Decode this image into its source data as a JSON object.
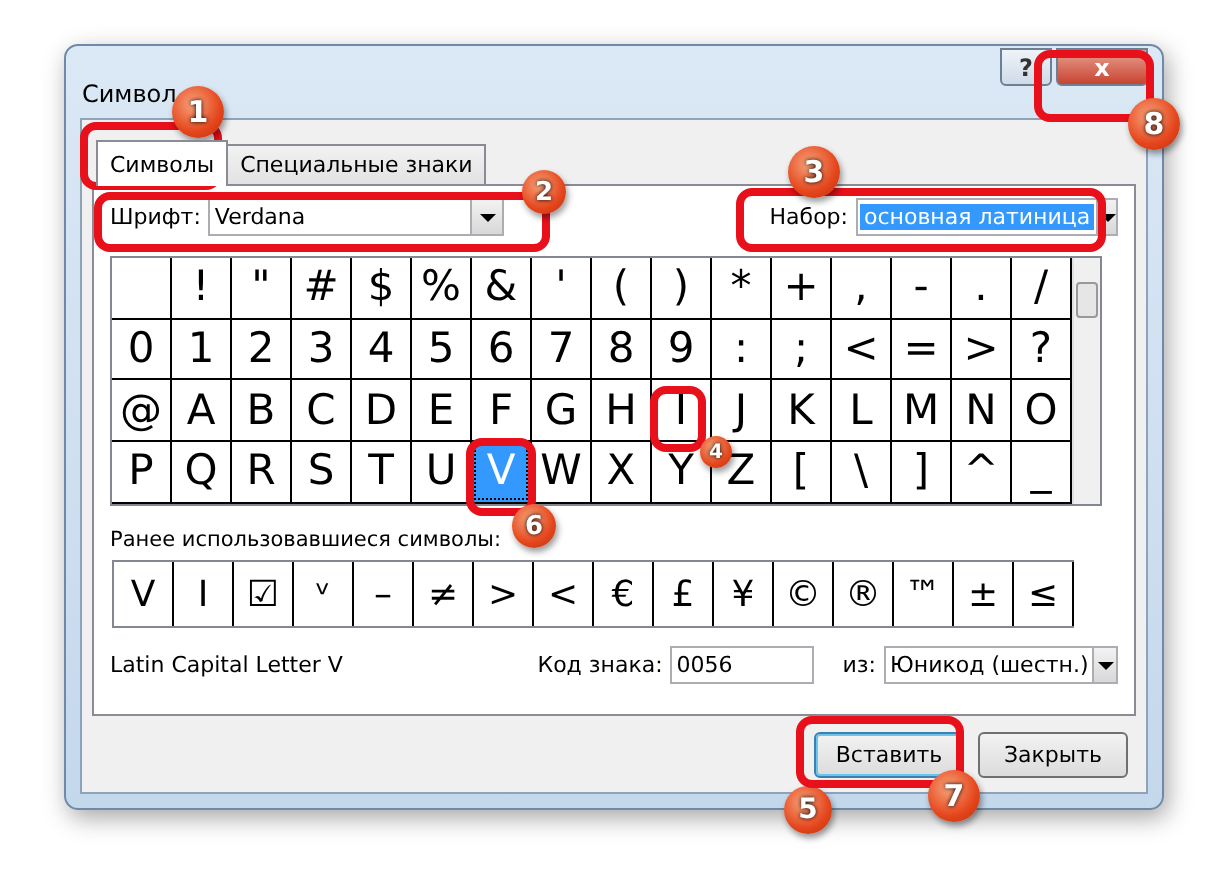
{
  "window": {
    "title": "Символ",
    "help_button": "?",
    "close_button": "x"
  },
  "tabs": [
    {
      "label": "Символы",
      "selected": true
    },
    {
      "label": "Специальные знаки",
      "selected": false
    }
  ],
  "font": {
    "label": "Шрифт:",
    "value": "Verdana"
  },
  "subset": {
    "label": "Набор:",
    "value": "основная латиница"
  },
  "symbols": [
    {
      "selected": false
    },
    {
      "char": "!",
      "selected": false
    },
    {
      "char": "\"",
      "selected": false
    },
    {
      "char": "#",
      "selected": false
    },
    {
      "char": "$",
      "selected": false
    },
    {
      "char": "%",
      "selected": false
    },
    {
      "char": "&",
      "selected": false
    },
    {
      "char": "'",
      "selected": false
    },
    {
      "char": "(",
      "selected": false
    },
    {
      "char": ")",
      "selected": false
    },
    {
      "char": "*",
      "selected": false
    },
    {
      "char": "+",
      "selected": false
    },
    {
      "char": ",",
      "selected": false
    },
    {
      "char": "-",
      "selected": false
    },
    {
      "char": ".",
      "selected": false
    },
    {
      "char": "/",
      "selected": false
    },
    {
      "char": "0",
      "selected": false
    },
    {
      "char": "1",
      "selected": false
    },
    {
      "char": "2",
      "selected": false
    },
    {
      "char": "3",
      "selected": false
    },
    {
      "char": "4",
      "selected": false
    },
    {
      "char": "5",
      "selected": false
    },
    {
      "char": "6",
      "selected": false
    },
    {
      "char": "7",
      "selected": false
    },
    {
      "char": "8",
      "selected": false
    },
    {
      "char": "9",
      "selected": false
    },
    {
      "char": ":",
      "selected": false
    },
    {
      "char": ";",
      "selected": false
    },
    {
      "char": "<",
      "selected": false
    },
    {
      "char": "=",
      "selected": false
    },
    {
      "char": ">",
      "selected": false
    },
    {
      "char": "?",
      "selected": false
    },
    {
      "char": "@",
      "selected": false
    },
    {
      "char": "A",
      "selected": false
    },
    {
      "char": "B",
      "selected": false
    },
    {
      "char": "C",
      "selected": false
    },
    {
      "char": "D",
      "selected": false
    },
    {
      "char": "E",
      "selected": false
    },
    {
      "char": "F",
      "selected": false
    },
    {
      "char": "G",
      "selected": false
    },
    {
      "char": "H",
      "selected": false
    },
    {
      "char": "I",
      "selected": false
    },
    {
      "char": "J",
      "selected": false
    },
    {
      "char": "K",
      "selected": false
    },
    {
      "char": "L",
      "selected": false
    },
    {
      "char": "M",
      "selected": false
    },
    {
      "char": "N",
      "selected": false
    },
    {
      "char": "O",
      "selected": false
    },
    {
      "char": "P",
      "selected": false
    },
    {
      "char": "Q",
      "selected": false
    },
    {
      "char": "R",
      "selected": false
    },
    {
      "char": "S",
      "selected": false
    },
    {
      "char": "T",
      "selected": false
    },
    {
      "char": "U",
      "selected": false
    },
    {
      "char": "V",
      "selected": true
    },
    {
      "char": "W",
      "selected": false
    },
    {
      "char": "X",
      "selected": false
    },
    {
      "char": "Y",
      "selected": false
    },
    {
      "char": "Z",
      "selected": false
    },
    {
      "char": "[",
      "selected": false
    },
    {
      "char": "\\",
      "selected": false
    },
    {
      "char": "]",
      "selected": false
    },
    {
      "char": "^",
      "selected": false
    },
    {
      "char": "_",
      "selected": false
    }
  ],
  "recent": {
    "label": "Ранее использовавшиеся символы:",
    "symbols": [
      "V",
      "I",
      "☑",
      "ᵛ",
      "–",
      "≠",
      ">",
      "<",
      "€",
      "£",
      "¥",
      "©",
      "®",
      "™",
      "±",
      "≤"
    ]
  },
  "char_name": "Latin Capital Letter V",
  "code": {
    "label": "Код знака:",
    "value": "0056"
  },
  "from": {
    "label": "из:",
    "value": "Юникод (шестн.)"
  },
  "buttons": [
    {
      "label": "Вставить",
      "default": true
    },
    {
      "label": "Закрыть",
      "default": false
    }
  ],
  "annotations": [
    {
      "number": "1"
    },
    {
      "number": "2"
    },
    {
      "number": "3"
    },
    {
      "number": "4"
    },
    {
      "number": "5"
    },
    {
      "number": "6"
    },
    {
      "number": "7"
    },
    {
      "number": "8"
    }
  ]
}
